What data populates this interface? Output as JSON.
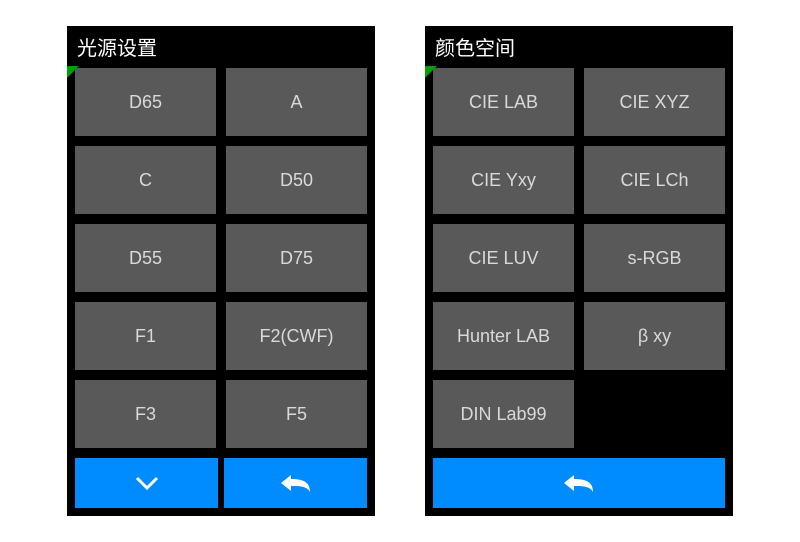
{
  "screens": [
    {
      "title": "光源设置",
      "options": [
        "D65",
        "A",
        "C",
        "D50",
        "D55",
        "D75",
        "F1",
        "F2(CWF)",
        "F3",
        "F5"
      ],
      "footer_buttons": [
        "down",
        "back"
      ]
    },
    {
      "title": "颜色空间",
      "options": [
        "CIE LAB",
        "CIE XYZ",
        "CIE Yxy",
        "CIE LCh",
        "CIE LUV",
        "s-RGB",
        "Hunter LAB",
        "β xy",
        "DIN Lab99"
      ],
      "footer_buttons": [
        "back"
      ]
    }
  ],
  "colors": {
    "accent": "#008cff",
    "button_bg": "#595959",
    "button_text": "#d9d9d9",
    "corner_mark": "#00a000"
  }
}
